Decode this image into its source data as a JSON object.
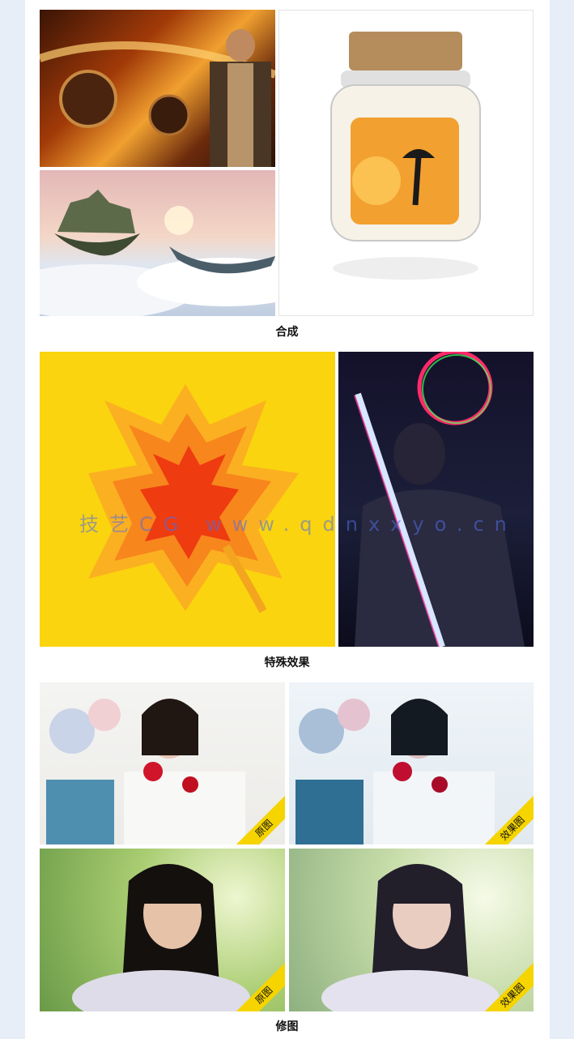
{
  "sections": {
    "composite": {
      "caption": "合成"
    },
    "effects": {
      "caption": "特殊效果"
    },
    "retouch": {
      "caption": "修图",
      "before_label": "原图",
      "after_label": "效果图"
    }
  },
  "watermark": "技艺CG  www.qdnxxyo.cn",
  "colors": {
    "leaf_background": "#fad40e",
    "ribbon": "#f5d400",
    "page_background": "#e8eef8"
  }
}
